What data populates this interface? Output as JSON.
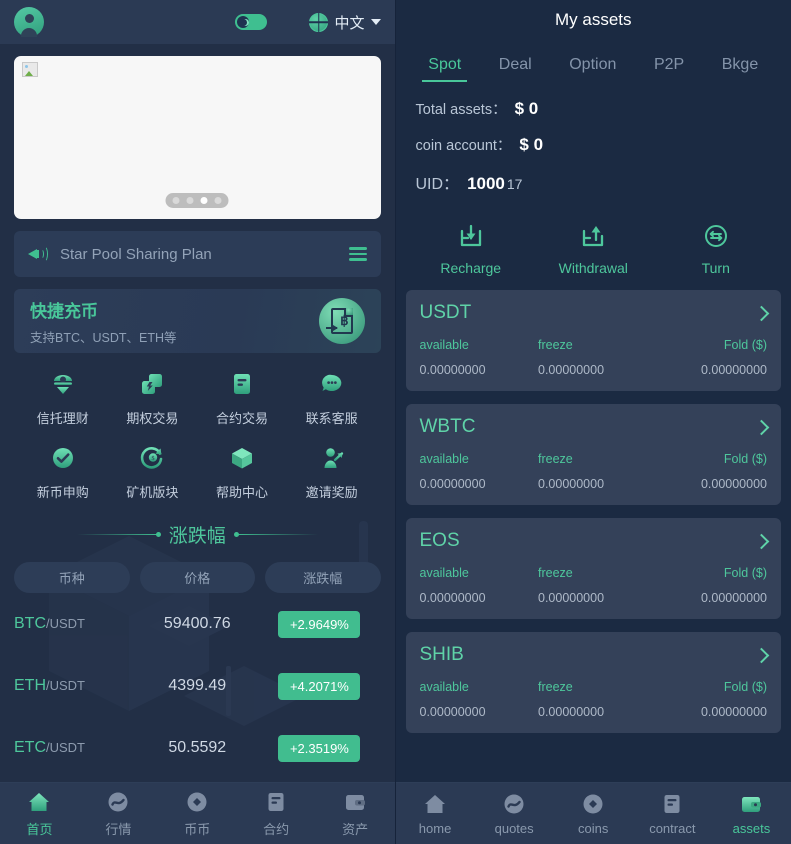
{
  "left": {
    "topbar": {
      "avatar": "user-avatar",
      "theme_toggle": "dark-mode-toggle",
      "language": "中文"
    },
    "banner": {
      "dots": 4,
      "active_dot": 2
    },
    "notice": {
      "text": "Star Pool Sharing Plan"
    },
    "quick_deposit": {
      "title": "快捷充币",
      "subtitle": "支持BTC、USDT、ETH等"
    },
    "grid": [
      {
        "label": "信托理财",
        "icon": "trust-finance-icon"
      },
      {
        "label": "期权交易",
        "icon": "options-trading-icon"
      },
      {
        "label": "合约交易",
        "icon": "contract-trading-icon"
      },
      {
        "label": "联系客服",
        "icon": "customer-service-icon"
      },
      {
        "label": "新币申购",
        "icon": "new-coin-subscription-icon"
      },
      {
        "label": "矿机版块",
        "icon": "mining-machine-icon"
      },
      {
        "label": "帮助中心",
        "icon": "help-center-icon"
      },
      {
        "label": "邀请奖励",
        "icon": "invite-reward-icon"
      }
    ],
    "market": {
      "title": "涨跌幅",
      "columns": [
        "币种",
        "价格",
        "涨跌幅"
      ],
      "rows": [
        {
          "base": "BTC",
          "quote": "/USDT",
          "price": "59400.76",
          "change": "+2.9649%"
        },
        {
          "base": "ETH",
          "quote": "/USDT",
          "price": "4399.49",
          "change": "+4.2071%"
        },
        {
          "base": "ETC",
          "quote": "/USDT",
          "price": "50.5592",
          "change": "+2.3519%"
        }
      ]
    },
    "tabbar": [
      {
        "label": "首页",
        "icon": "home-icon",
        "active": true
      },
      {
        "label": "行情",
        "icon": "quotes-icon",
        "active": false
      },
      {
        "label": "币币",
        "icon": "coins-icon",
        "active": false
      },
      {
        "label": "合约",
        "icon": "contract-icon",
        "active": false
      },
      {
        "label": "资产",
        "icon": "assets-icon",
        "active": false
      }
    ]
  },
  "right": {
    "title": "My assets",
    "tabs": [
      {
        "label": "Spot",
        "active": true
      },
      {
        "label": "Deal",
        "active": false
      },
      {
        "label": "Option",
        "active": false
      },
      {
        "label": "P2P",
        "active": false
      },
      {
        "label": "Bkge",
        "active": false
      }
    ],
    "summary": {
      "total_assets_label": "Total assets：",
      "total_assets_value": "$ 0",
      "coin_account_label": "coin account：",
      "coin_account_value": "$ 0",
      "uid_label": "UID：",
      "uid_value": "1000",
      "uid_suffix": "17"
    },
    "actions": [
      {
        "label": "Recharge",
        "icon": "recharge-icon"
      },
      {
        "label": "Withdrawal",
        "icon": "withdrawal-icon"
      },
      {
        "label": "Turn",
        "icon": "transfer-icon"
      }
    ],
    "card_labels": {
      "available": "available",
      "freeze": "freeze",
      "fold": "Fold ($)"
    },
    "cards": [
      {
        "symbol": "USDT",
        "available": "0.00000000",
        "freeze": "0.00000000",
        "fold": "0.00000000"
      },
      {
        "symbol": "WBTC",
        "available": "0.00000000",
        "freeze": "0.00000000",
        "fold": "0.00000000"
      },
      {
        "symbol": "EOS",
        "available": "0.00000000",
        "freeze": "0.00000000",
        "fold": "0.00000000"
      },
      {
        "symbol": "SHIB",
        "available": "0.00000000",
        "freeze": "0.00000000",
        "fold": "0.00000000"
      }
    ],
    "tabbar": [
      {
        "label": "home",
        "icon": "home-icon",
        "active": false
      },
      {
        "label": "quotes",
        "icon": "quotes-icon",
        "active": false
      },
      {
        "label": "coins",
        "icon": "coins-icon",
        "active": false
      },
      {
        "label": "contract",
        "icon": "contract-icon",
        "active": false
      },
      {
        "label": "assets",
        "icon": "assets-icon",
        "active": true
      }
    ]
  },
  "colors": {
    "accent_green": "#49c79a",
    "badge_green": "#41bd8f",
    "page_bg": "#1b2a42",
    "panel_bg": "#222f46",
    "card_bg": "#344159"
  }
}
